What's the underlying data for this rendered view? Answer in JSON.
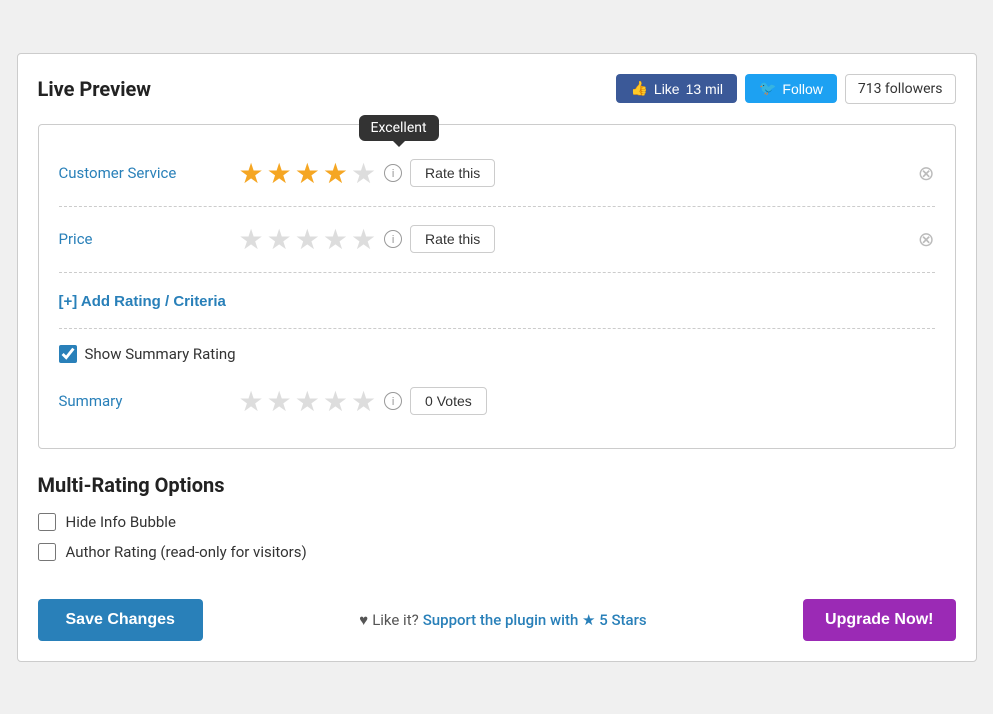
{
  "panel": {
    "title": "Live Preview"
  },
  "header": {
    "like_label": "Like",
    "like_count": "13 mil",
    "follow_label": "Follow",
    "followers_text": "713 followers"
  },
  "preview": {
    "tooltip_text": "Excellent",
    "customer_service": {
      "label": "Customer Service",
      "filled_stars": 4,
      "total_stars": 5,
      "rate_label": "Rate this"
    },
    "price": {
      "label": "Price",
      "filled_stars": 0,
      "total_stars": 5,
      "rate_label": "Rate this"
    },
    "add_criteria_label": "[+] Add Rating / Criteria",
    "show_summary_label": "Show Summary Rating",
    "show_summary_checked": true,
    "summary": {
      "label": "Summary",
      "filled_stars": 0,
      "total_stars": 5,
      "votes_label": "0 Votes"
    }
  },
  "options": {
    "title": "Multi-Rating Options",
    "hide_info_bubble_label": "Hide Info Bubble",
    "hide_info_bubble_checked": false,
    "author_rating_label": "Author Rating (read-only for visitors)",
    "author_rating_checked": false
  },
  "footer": {
    "save_label": "Save Changes",
    "heart": "♥",
    "like_text": "Like it?",
    "support_link_text": "Support the plugin with ★ 5 Stars",
    "upgrade_label": "Upgrade Now!"
  }
}
